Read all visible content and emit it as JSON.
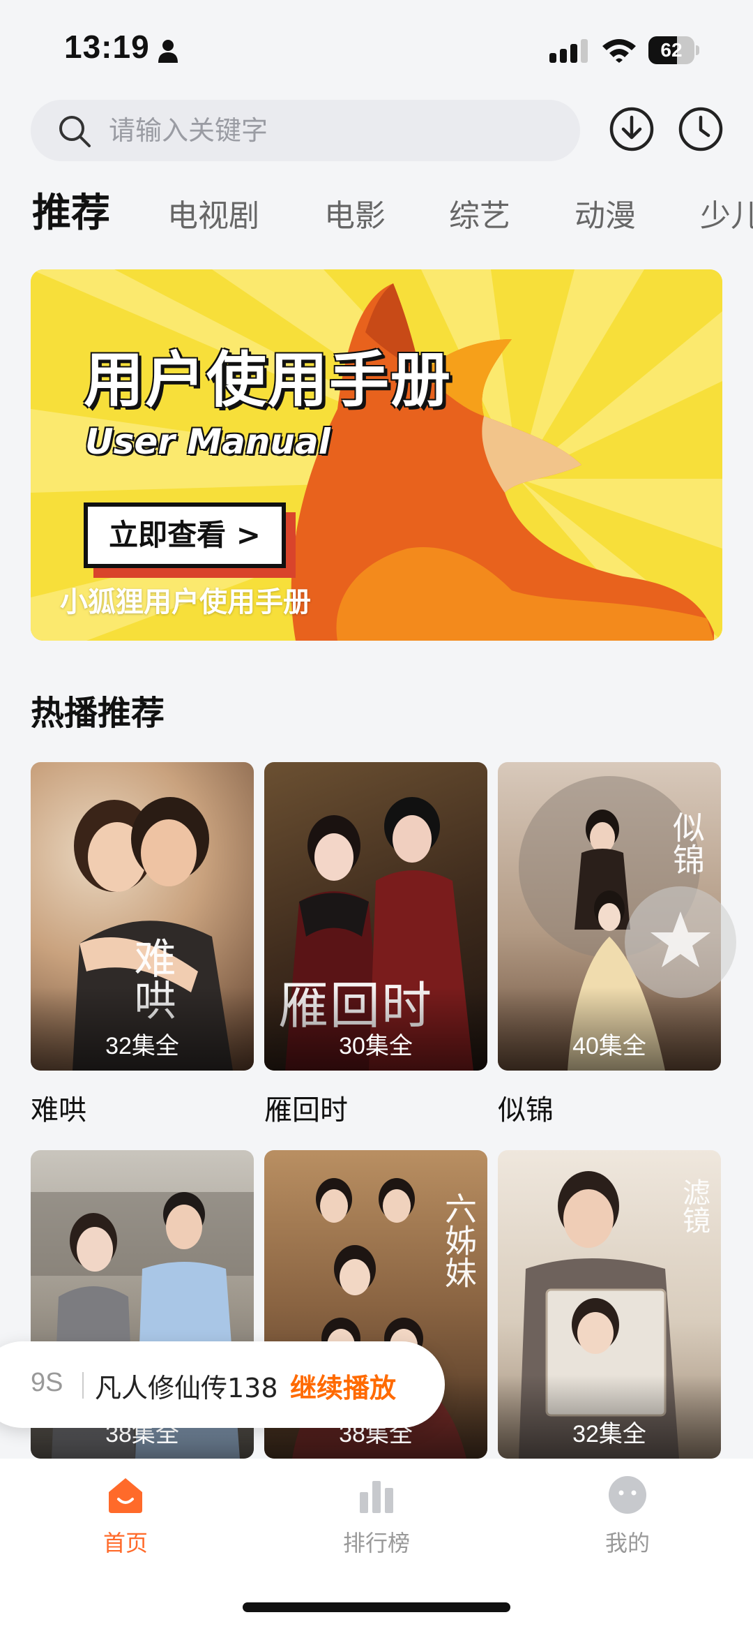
{
  "status_bar": {
    "time": "13:19",
    "battery": "62",
    "battery_level": 0.62
  },
  "search": {
    "placeholder": "请输入关键字"
  },
  "tabs": [
    {
      "label": "推荐",
      "active": true
    },
    {
      "label": "电视剧",
      "active": false
    },
    {
      "label": "电影",
      "active": false
    },
    {
      "label": "综艺",
      "active": false
    },
    {
      "label": "动漫",
      "active": false
    },
    {
      "label": "少儿",
      "active": false
    }
  ],
  "banner": {
    "headline": "用户使用手册",
    "subtitle": "User Manual",
    "cta": "立即查看 >",
    "caption": "小狐狸用户使用手册"
  },
  "section": {
    "title": "热播推荐"
  },
  "cards": [
    {
      "title": "难哄",
      "episodes": "32集全",
      "calligraphy": "难哄"
    },
    {
      "title": "雁回时",
      "episodes": "30集全",
      "calligraphy": "雁回时"
    },
    {
      "title": "似锦",
      "episodes": "40集全",
      "calligraphy": "似锦"
    },
    {
      "title": "",
      "episodes": "38集全",
      "calligraphy": ""
    },
    {
      "title": "",
      "episodes": "38集全",
      "calligraphy": "六姊妹"
    },
    {
      "title": "",
      "episodes": "32集全",
      "calligraphy": "滤镜"
    }
  ],
  "continue_watching": {
    "time": "9S",
    "show": "凡人修仙传138",
    "action": "继续播放"
  },
  "bottom_nav": [
    {
      "label": "首页",
      "icon": "home-icon",
      "active": true
    },
    {
      "label": "排行榜",
      "icon": "ranking-icon",
      "active": false
    },
    {
      "label": "我的",
      "icon": "profile-icon",
      "active": false
    }
  ],
  "colors": {
    "accent": "#ff6a2a",
    "banner_yellow": "#f7df3a",
    "fox_orange": "#e8621d"
  }
}
